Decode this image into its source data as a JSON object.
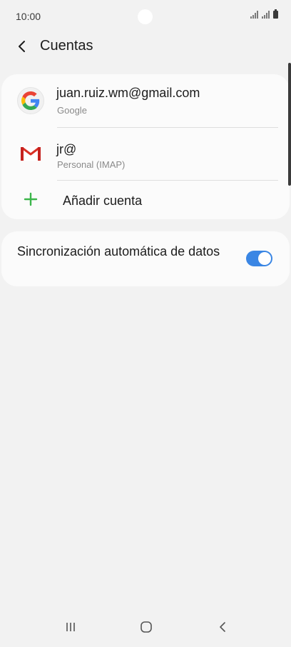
{
  "status_bar": {
    "time": "10:00",
    "icons": [
      "signal-icon",
      "signal-icon",
      "battery-icon"
    ]
  },
  "header": {
    "back_icon": "back-arrow-icon",
    "title": "Cuentas"
  },
  "accounts": [
    {
      "name": "juan.ruiz.wm@gmail.com",
      "type": "Google",
      "icon": "google-icon"
    },
    {
      "name": "jr@",
      "type": "Personal (IMAP)",
      "icon": "gmail-icon"
    }
  ],
  "add_account": {
    "label": "Añadir cuenta",
    "icon": "plus-icon"
  },
  "sync": {
    "label": "Sincronización automática de datos",
    "enabled": true
  },
  "colors": {
    "toggle_on": "#3a86e4",
    "plus": "#3bb54a",
    "background": "#f2f2f2",
    "card": "#fbfbfb"
  },
  "nav_bar": {
    "buttons": [
      "recents-icon",
      "home-icon",
      "back-icon"
    ]
  }
}
